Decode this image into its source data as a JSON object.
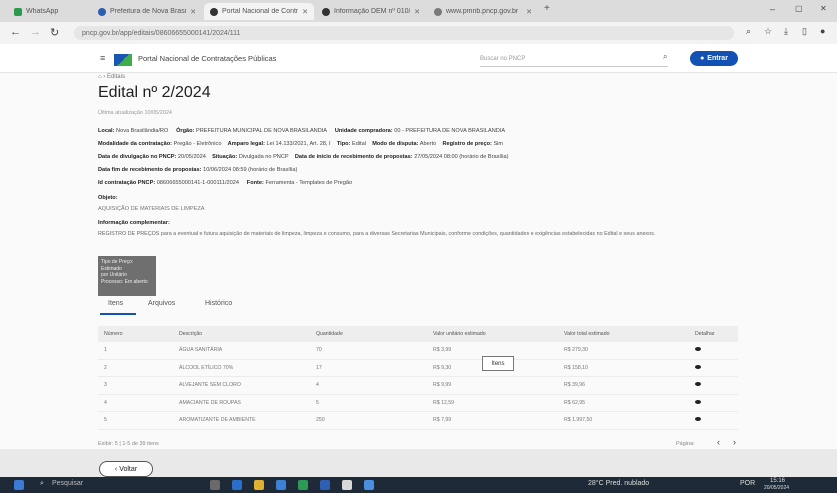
{
  "browser": {
    "tabs": [
      {
        "label": "WhatsApp"
      },
      {
        "label": "Prefeitura de Nova Brasilândia"
      },
      {
        "label": "Portal Nacional de Contratações"
      },
      {
        "label": "Informação DEM nº 010/"
      },
      {
        "label": "www.pmnb.pncp.gov.br"
      }
    ],
    "address": "pncp.gov.br/app/editais/08606655000141/2024/111"
  },
  "site": {
    "name": "Portal Nacional de Contratações Públicas",
    "search_placeholder": "Buscar no PNCP",
    "enter_label": "Entrar"
  },
  "breadcrumb": {
    "current": "Editais"
  },
  "edital": {
    "title": "Edital nº 2/2024",
    "last_update": "Última atualização 10/05/2024",
    "local_label": "Local:",
    "local": "Nova Brasilândia/RO",
    "orgao_label": "Órgão:",
    "orgao": "PREFEITURA MUNICIPAL DE NOVA BRASILANDIA",
    "unidade_label": "Unidade compradora:",
    "unidade": "00 - PREFEITURA DE NOVA BRASILANDIA",
    "modalidade_label": "Modalidade da contratação:",
    "modalidade": "Pregão - Eletrônico",
    "amparo_label": "Amparo legal:",
    "amparo": "Lei 14.133/2021, Art. 28, I",
    "tipo_label": "Tipo:",
    "tipo": "Edital",
    "modo_label": "Modo de disputa:",
    "modo": "Aberto",
    "registro_label": "Registro de preço:",
    "registro": "Sim",
    "divulgacao_label": "Data de divulgação no PNCP:",
    "divulgacao": "20/05/2024",
    "situacao_label": "Situação:",
    "situacao": "Divulgada no PNCP",
    "inicio_label": "Data de início de recebimento de propostas:",
    "inicio": "27/05/2024 08:00 (horário de Brasília)",
    "fim_label": "Data fim de recebimento de propostas:",
    "fim": "10/06/2024 08:59 (horário de Brasília)",
    "id_label": "Id contratação PNCP:",
    "id": "08606655000141-1-000111/2024",
    "fonte_label": "Fonte:",
    "fonte": "Ferramenta - Templates de Pregão",
    "objeto_label": "Objeto:",
    "objeto": "AQUISIÇÃO DE MATERIAIS DE LIMPEZA",
    "info_label": "Informação complementar:",
    "info": "REGISTRO DE PREÇOS para a eventual e futura aquisição de materiais de limpeza, limpeza e consumo, para a diversas Secretarias Municipais, conforme condições, quantidades e exigências estabelecidas no Edital e seus anexos.",
    "thumb_lines": [
      "Tipo de Preço: Estimado",
      "por Unitário",
      "",
      "Processo: Em aberto"
    ]
  },
  "tabs_nav": [
    {
      "label": "Itens"
    },
    {
      "label": "Arquivos"
    },
    {
      "label": "Histórico"
    }
  ],
  "items_table": {
    "headers": [
      "Número",
      "Descrição",
      "Quantidade",
      "Valor unitário estimado",
      "Valor total estimado",
      "Detalhar"
    ],
    "rows": [
      [
        "1",
        "ÁGUA SANITÁRIA",
        "70",
        "R$ 3,99",
        "R$ 279,30",
        ""
      ],
      [
        "2",
        "ÁLCOOL ETÍLICO 70%",
        "17",
        "R$ 9,30",
        "R$ 158,10",
        ""
      ],
      [
        "3",
        "ALVEJANTE SEM CLORO",
        "4",
        "R$ 9,99",
        "R$ 39,96",
        ""
      ],
      [
        "4",
        "AMACIANTE DE ROUPAS",
        "5",
        "R$ 12,59",
        "R$ 62,95",
        ""
      ],
      [
        "5",
        "AROMATIZANTE DE AMBIENTE",
        "250",
        "R$ 7,99",
        "R$ 1.997,50",
        ""
      ]
    ],
    "tooltip": "Itens",
    "footer_left": "Exibir: 5 | 1-5 de 39 itens",
    "footer_right": "Página:",
    "prev": "‹",
    "next": "›"
  },
  "voltar_label": "Voltar",
  "taskbar": {
    "search": "Pesquisar",
    "weather": "28°C Pred. nublado",
    "lang": "POR",
    "time": "15:16",
    "date": "20/05/2024"
  },
  "colors": {
    "primary": "#1351b4",
    "taskbar": "#1f2a38"
  }
}
